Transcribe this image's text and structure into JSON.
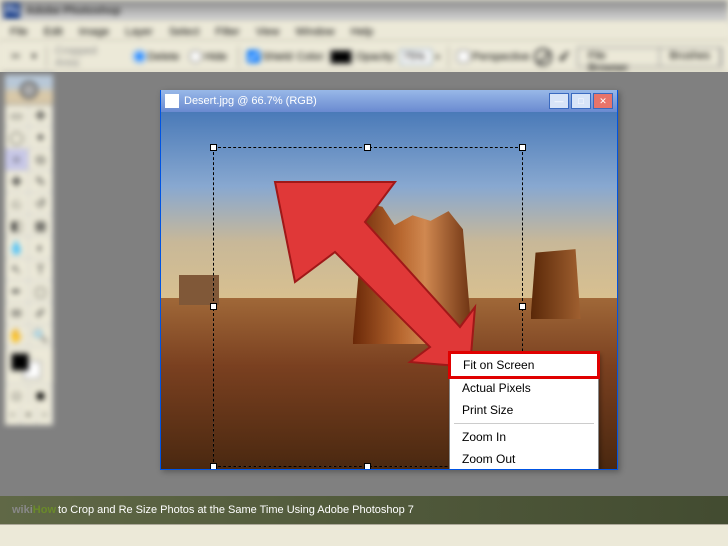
{
  "app": {
    "title": "Adobe Photoshop"
  },
  "menu": [
    "File",
    "Edit",
    "Image",
    "Layer",
    "Select",
    "Filter",
    "View",
    "Window",
    "Help"
  ],
  "options": {
    "cropped_area": "Cropped Area:",
    "radio_delete": "Delete",
    "radio_hide": "Hide",
    "shield": "Shield",
    "color": "Color:",
    "opacity_label": "Opacity:",
    "opacity_value": "75%",
    "perspective": "Perspective",
    "file_browser": "File Browser",
    "brushes": "Brushes"
  },
  "document": {
    "title": "Desert.jpg @ 66.7% (RGB)"
  },
  "context_menu": {
    "items": [
      "Fit on Screen",
      "Actual Pixels",
      "Print Size",
      "Zoom In",
      "Zoom Out"
    ],
    "highlighted": "Fit on Screen"
  },
  "caption": {
    "prefix_wiki": "wiki",
    "prefix_how": "How",
    "text": "to Crop and Re Size Photos at the Same Time Using Adobe Photoshop 7"
  }
}
